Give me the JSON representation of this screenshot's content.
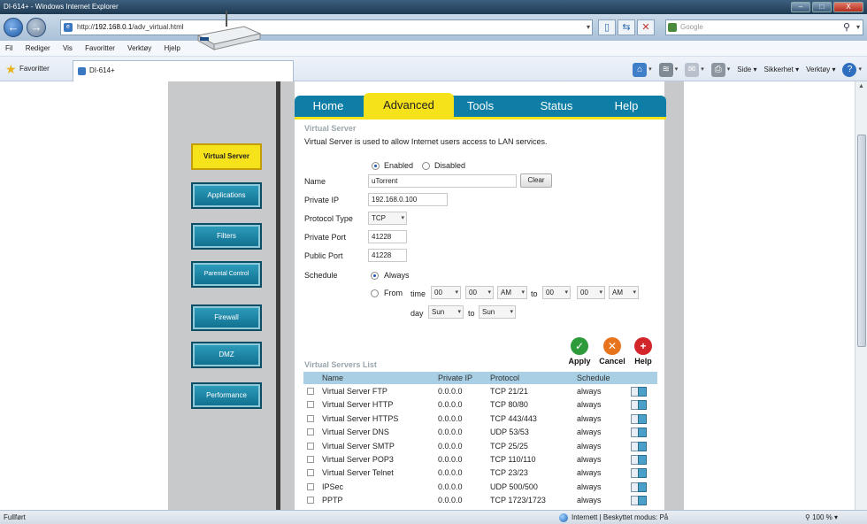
{
  "window": {
    "title": "DI-614+ - Windows Internet Explorer",
    "minimize": "–",
    "maximize": "□",
    "close": "X"
  },
  "addressbar": {
    "url_prefix": "http://",
    "url_host": "192.168.0.1",
    "url_path": "/adv_virtual.html",
    "search_placeholder": "Google"
  },
  "menu": [
    "Fil",
    "Rediger",
    "Vis",
    "Favoritter",
    "Verktøy",
    "Hjelp"
  ],
  "favbar": {
    "favorites_label": "Favoritter",
    "tab_title": "DI-614+",
    "tools": [
      "Side",
      "Sikkerhet",
      "Verktøy"
    ]
  },
  "router": {
    "top_tabs": [
      "Home",
      "Advanced",
      "Tools",
      "Status",
      "Help"
    ],
    "active_tab": "Advanced",
    "left_nav": [
      "Virtual Server",
      "Applications",
      "Filters",
      "Parental Control",
      "Firewall",
      "DMZ",
      "Performance"
    ],
    "active_nav": "Virtual Server"
  },
  "virtual_server": {
    "title": "Virtual Server",
    "description": "Virtual Server is used to allow Internet users access to LAN services.",
    "enabled_label": "Enabled",
    "disabled_label": "Disabled",
    "enabled": true,
    "name_label": "Name",
    "name_value": "uTorrent",
    "clear_label": "Clear",
    "private_ip_label": "Private IP",
    "private_ip_value": "192.168.0.100",
    "protocol_type_label": "Protocol Type",
    "protocol_type_value": "TCP",
    "private_port_label": "Private Port",
    "private_port_value": "41228",
    "public_port_label": "Public Port",
    "public_port_value": "41228",
    "schedule_label": "Schedule",
    "always_label": "Always",
    "from_label": "From",
    "time_label": "time",
    "to_label": "to",
    "day_label": "day",
    "from_hour": "00",
    "from_min": "00",
    "from_ampm": "AM",
    "to_hour": "00",
    "to_min": "00",
    "to_ampm": "AM",
    "from_day": "Sun",
    "to_day": "Sun"
  },
  "actions": {
    "apply": "Apply",
    "cancel": "Cancel",
    "help": "Help"
  },
  "list": {
    "title": "Virtual Servers List",
    "columns": [
      "Name",
      "Private IP",
      "Protocol",
      "Schedule"
    ],
    "rows": [
      {
        "name": "Virtual Server FTP",
        "ip": "0.0.0.0",
        "protocol": "TCP 21/21",
        "schedule": "always"
      },
      {
        "name": "Virtual Server HTTP",
        "ip": "0.0.0.0",
        "protocol": "TCP 80/80",
        "schedule": "always"
      },
      {
        "name": "Virtual Server HTTPS",
        "ip": "0.0.0.0",
        "protocol": "TCP 443/443",
        "schedule": "always"
      },
      {
        "name": "Virtual Server DNS",
        "ip": "0.0.0.0",
        "protocol": "UDP 53/53",
        "schedule": "always"
      },
      {
        "name": "Virtual Server SMTP",
        "ip": "0.0.0.0",
        "protocol": "TCP 25/25",
        "schedule": "always"
      },
      {
        "name": "Virtual Server POP3",
        "ip": "0.0.0.0",
        "protocol": "TCP 110/110",
        "schedule": "always"
      },
      {
        "name": "Virtual Server Telnet",
        "ip": "0.0.0.0",
        "protocol": "TCP 23/23",
        "schedule": "always"
      },
      {
        "name": "IPSec",
        "ip": "0.0.0.0",
        "protocol": "UDP 500/500",
        "schedule": "always"
      },
      {
        "name": "PPTP",
        "ip": "0.0.0.0",
        "protocol": "TCP 1723/1723",
        "schedule": "always"
      }
    ]
  },
  "statusbar": {
    "left": "Fullført",
    "zone": "Internett | Beskyttet modus: På",
    "zoom": "100 %"
  },
  "colors": {
    "accent_yellow": "#f6e21b",
    "tab_blue": "#0e7ea6",
    "list_header": "#a8cfe3"
  }
}
